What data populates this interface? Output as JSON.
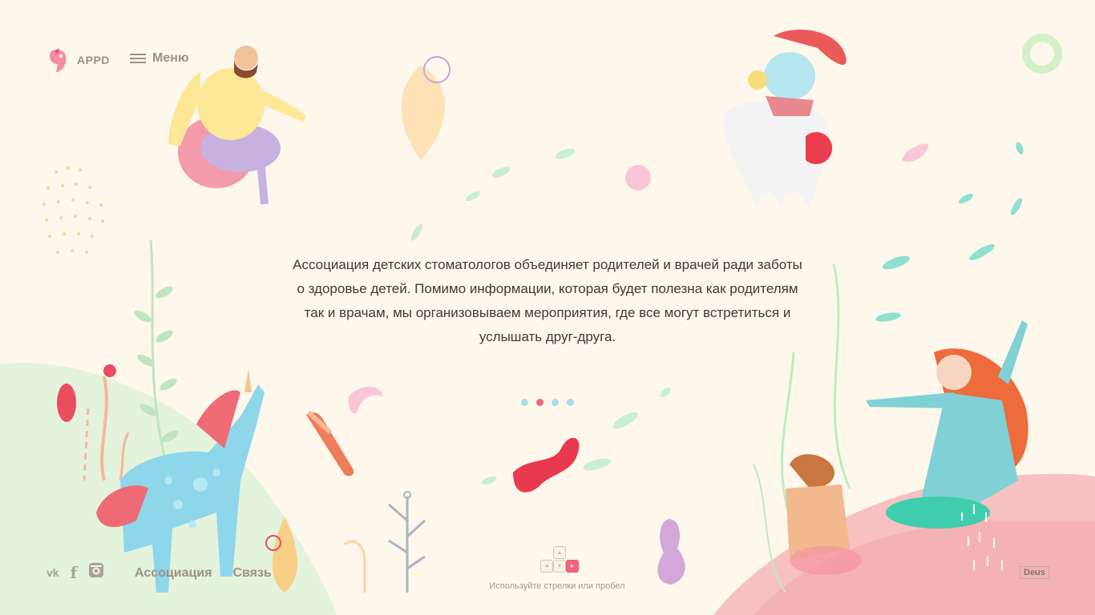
{
  "header": {
    "brand": "APPD",
    "menu_label": "Меню"
  },
  "intro": {
    "text": "Ассоциация детских стоматологов объединяет родителей и врачей ради заботы о здоровье детей. Помимо информации, которая будет полезна как родителям так и врачам, мы организовываем мероприятия, где все могут встретиться и услышать друг-друга."
  },
  "slider": {
    "active_index": 1,
    "count": 4
  },
  "footer": {
    "social": [
      {
        "name": "vk-icon",
        "glyph": "vk"
      },
      {
        "name": "facebook-icon",
        "glyph": "f"
      },
      {
        "name": "instagram-icon",
        "glyph": ""
      }
    ],
    "links": [
      "Ассоциация",
      "Связь"
    ],
    "hint": "Используйте стрелки или пробел",
    "credit": "Deus"
  },
  "colors": {
    "background": "#fdf7ec",
    "accent": "#f2657b",
    "dot": "#a6dcef",
    "muted_text": "#9a9187"
  }
}
